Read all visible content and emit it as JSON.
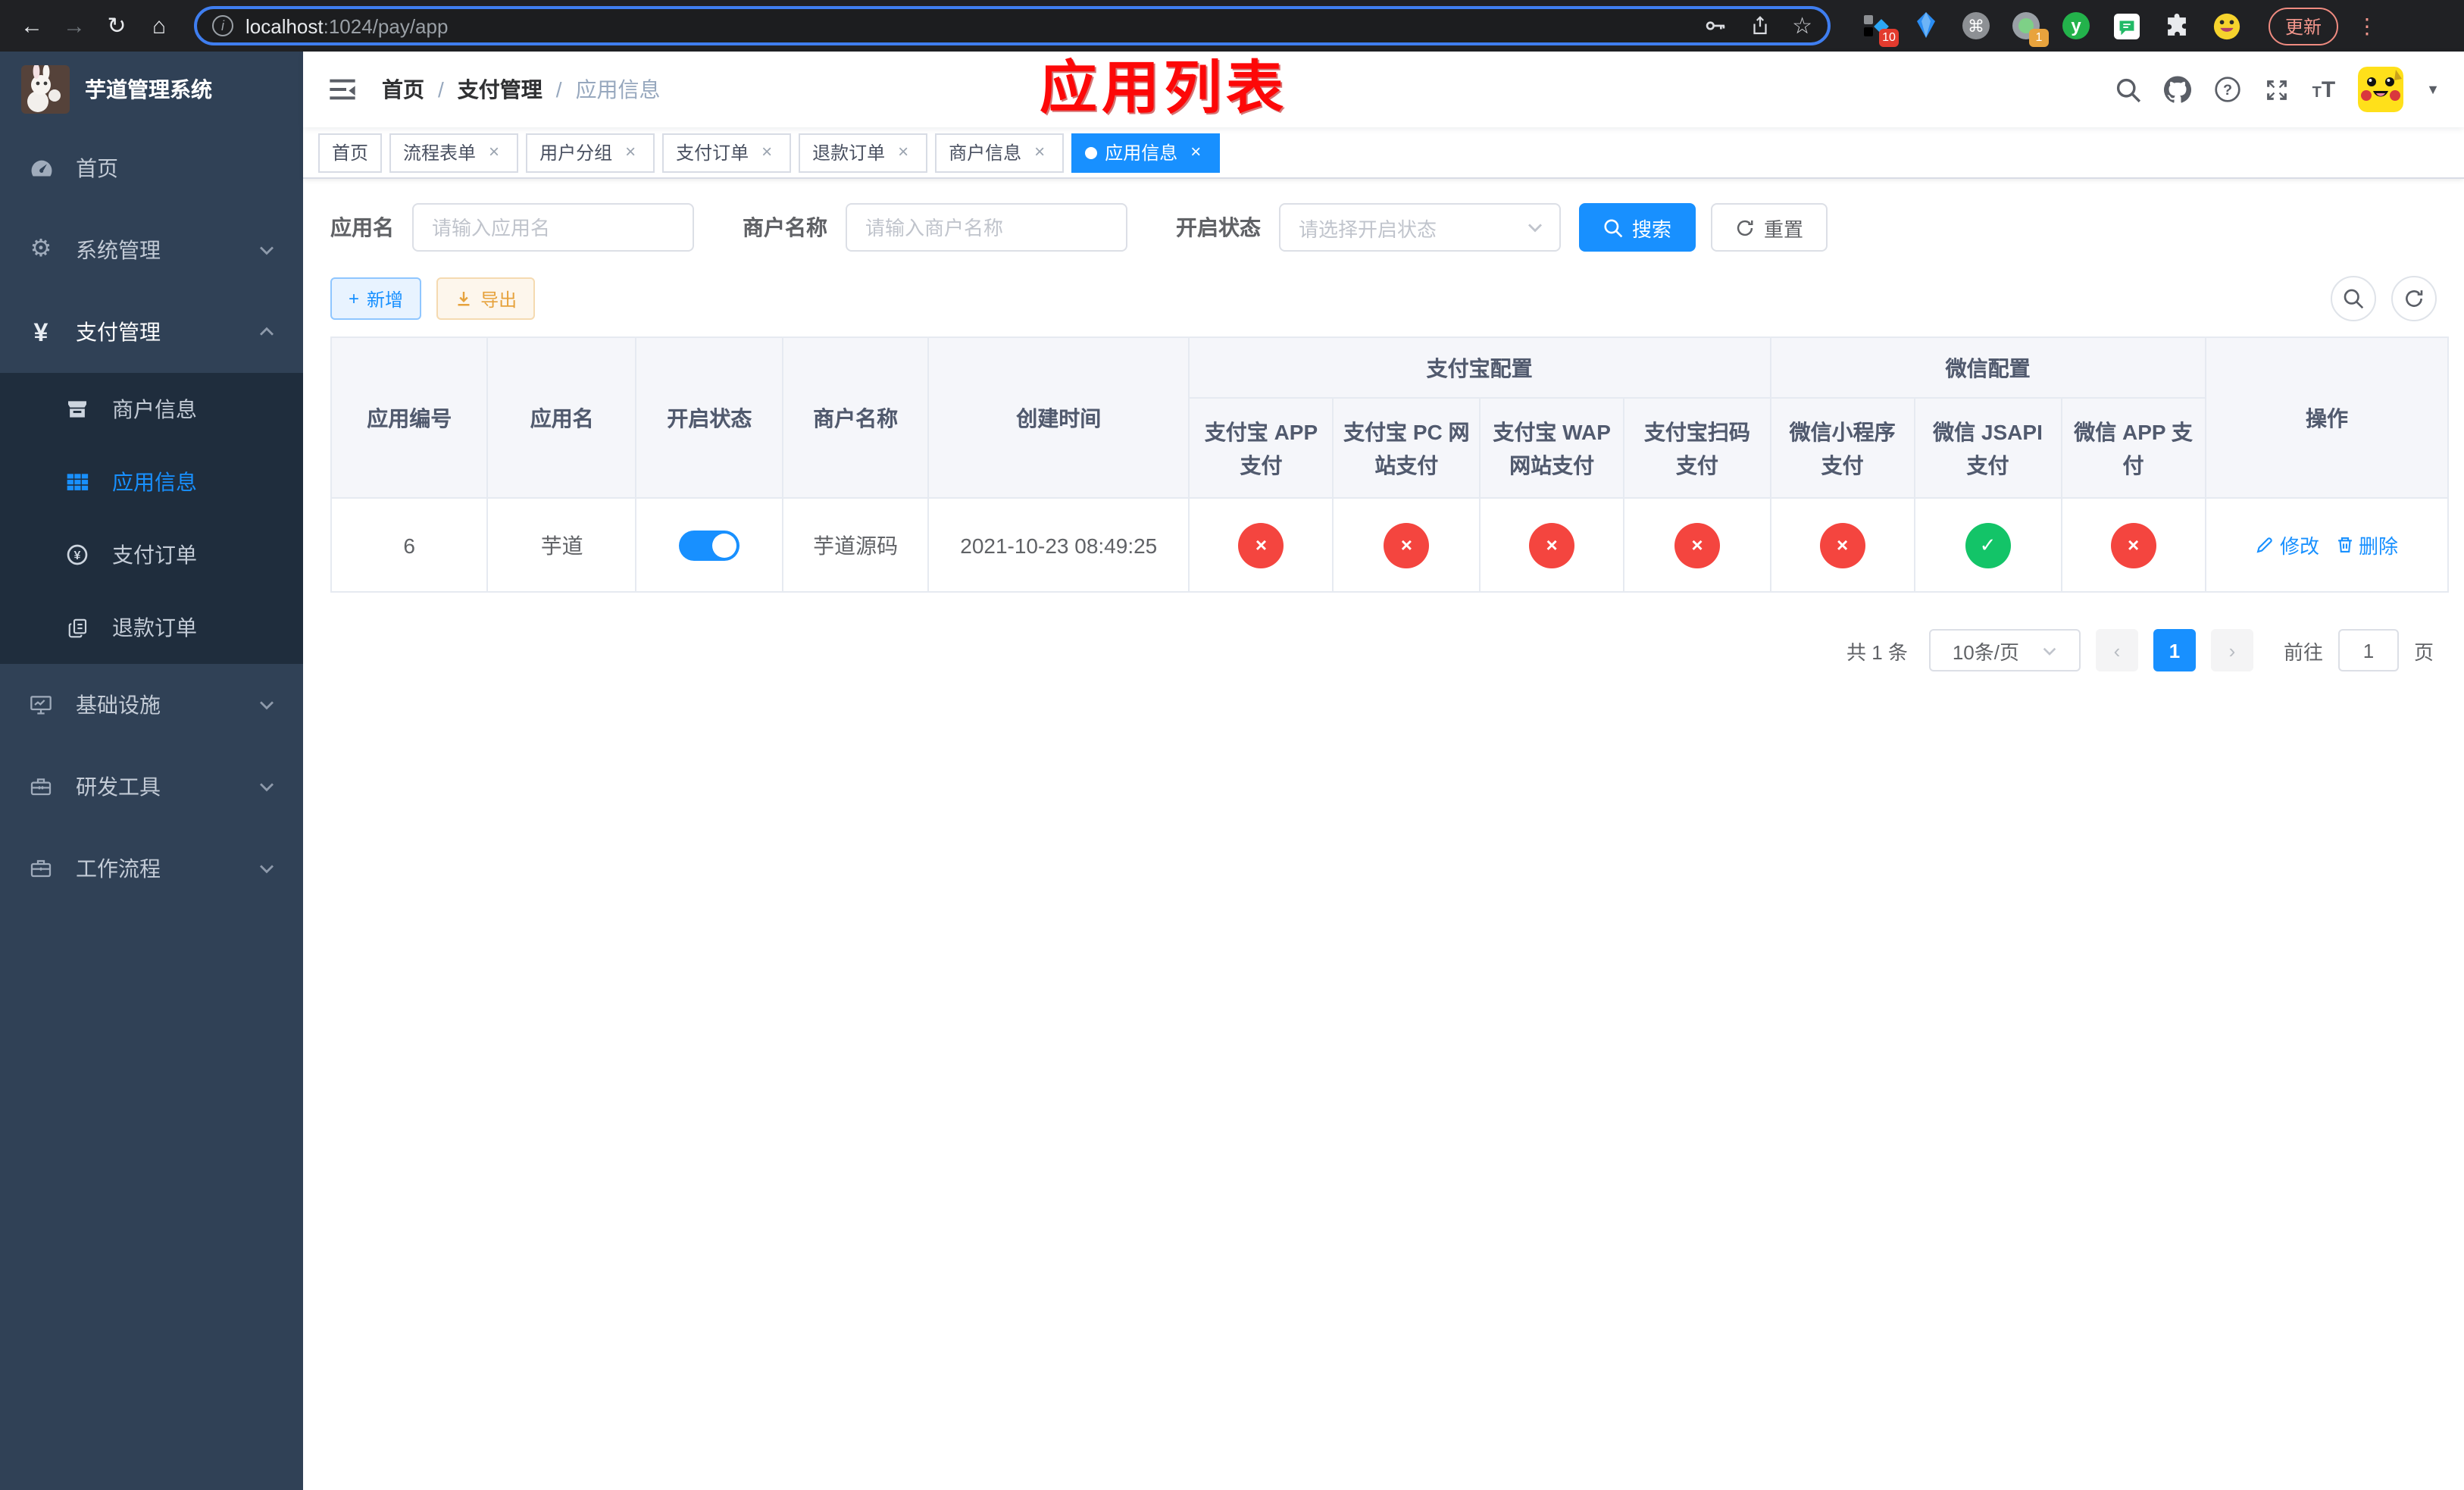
{
  "browser": {
    "url_host": "localhost",
    "url_path": ":1024/pay/app",
    "update_label": "更新",
    "badges": {
      "ext1": "10",
      "ext4": "1"
    },
    "ext_y_label": "y"
  },
  "sidebar": {
    "title": "芋道管理系统",
    "items": [
      {
        "id": "home",
        "label": "首页",
        "icon": "dashboard-icon"
      },
      {
        "id": "system",
        "label": "系统管理",
        "icon": "gear-icon",
        "chevron": "down"
      },
      {
        "id": "payment",
        "label": "支付管理",
        "icon": "yen-icon",
        "chevron": "up",
        "active_parent": true,
        "children": [
          {
            "id": "merchant-info",
            "label": "商户信息",
            "icon": "store-icon"
          },
          {
            "id": "app-info",
            "label": "应用信息",
            "icon": "grid-icon",
            "active": true
          },
          {
            "id": "pay-order",
            "label": "支付订单",
            "icon": "pay-order-icon"
          },
          {
            "id": "refund-order",
            "label": "退款订单",
            "icon": "refund-docs-icon"
          }
        ]
      },
      {
        "id": "infra",
        "label": "基础设施",
        "icon": "monitor-icon",
        "chevron": "down"
      },
      {
        "id": "devtools",
        "label": "研发工具",
        "icon": "toolbox-icon",
        "chevron": "down"
      },
      {
        "id": "workflow",
        "label": "工作流程",
        "icon": "briefcase-icon",
        "chevron": "down"
      }
    ]
  },
  "navbar": {
    "breadcrumb": [
      "首页",
      "支付管理",
      "应用信息"
    ],
    "annotation": "应用列表"
  },
  "tabs": [
    {
      "id": "home",
      "label": "首页",
      "closable": false
    },
    {
      "id": "flow-form",
      "label": "流程表单",
      "closable": true
    },
    {
      "id": "user-group",
      "label": "用户分组",
      "closable": true
    },
    {
      "id": "pay-order",
      "label": "支付订单",
      "closable": true
    },
    {
      "id": "refund-order",
      "label": "退款订单",
      "closable": true
    },
    {
      "id": "merchant-info",
      "label": "商户信息",
      "closable": true
    },
    {
      "id": "app-info",
      "label": "应用信息",
      "closable": true,
      "active": true
    }
  ],
  "filters": {
    "app_name_label": "应用名",
    "app_name_placeholder": "请输入应用名",
    "merchant_label": "商户名称",
    "merchant_placeholder": "请输入商户名称",
    "status_label": "开启状态",
    "status_placeholder": "请选择开启状态",
    "search_label": "搜索",
    "reset_label": "重置"
  },
  "toolbar": {
    "add_label": "新增",
    "export_label": "导出"
  },
  "table": {
    "main_headers": [
      "应用编号",
      "应用名",
      "开启状态",
      "商户名称",
      "创建时间"
    ],
    "groups": [
      {
        "label": "支付宝配置",
        "columns": [
          "支付宝 APP 支付",
          "支付宝 PC 网站支付",
          "支付宝 WAP 网站支付",
          "支付宝扫码支付"
        ]
      },
      {
        "label": "微信配置",
        "columns": [
          "微信小程序支付",
          "微信 JSAPI 支付",
          "微信 APP 支付"
        ]
      }
    ],
    "action_header": "操作",
    "rows": [
      {
        "app_id": "6",
        "app_name": "芋道",
        "enabled": true,
        "merchant_name": "芋道源码",
        "create_time": "2021-10-23 08:49:25",
        "statuses": [
          false,
          false,
          false,
          false,
          false,
          true,
          false
        ],
        "edit_label": "修改",
        "delete_label": "删除"
      }
    ]
  },
  "pagination": {
    "total_label": "共 1 条",
    "page_size_label": "10条/页",
    "current_page": "1",
    "goto_label": "前往",
    "goto_value": "1",
    "unit_label": "页"
  },
  "colors": {
    "primary": "#1890ff",
    "success": "#13c468",
    "danger": "#f4453f",
    "sidebar_bg": "#304156",
    "submenu_bg": "#1f2d3d",
    "annotation_red": "#fd0808"
  }
}
